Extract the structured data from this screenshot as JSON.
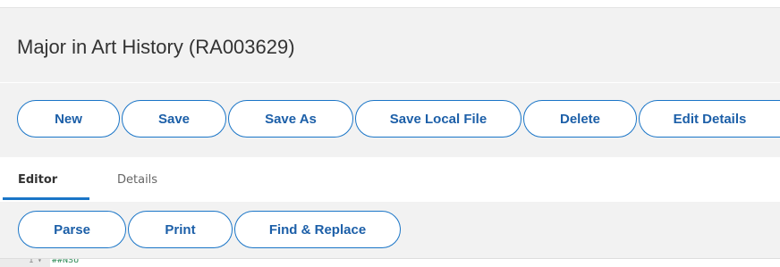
{
  "header": {
    "title": "Major in Art History (RA003629)"
  },
  "toolbar": {
    "buttons": [
      {
        "label": "New"
      },
      {
        "label": "Save"
      },
      {
        "label": "Save As"
      },
      {
        "label": "Save Local File"
      },
      {
        "label": "Delete"
      },
      {
        "label": "Edit Details"
      }
    ]
  },
  "tabs": {
    "items": [
      {
        "label": "Editor",
        "active": true
      },
      {
        "label": "Details",
        "active": false
      }
    ]
  },
  "editor_toolbar": {
    "buttons": [
      {
        "label": "Parse"
      },
      {
        "label": "Print"
      },
      {
        "label": "Find & Replace"
      }
    ]
  },
  "code_editor": {
    "line_number": "1",
    "fold_icon": "chevron-down-icon",
    "first_line": "##NSU"
  },
  "colors": {
    "accent": "#1a75c7",
    "button_text": "#1c5fa8",
    "panel_bg": "#f2f2f2",
    "code_text": "#2e8b57"
  }
}
